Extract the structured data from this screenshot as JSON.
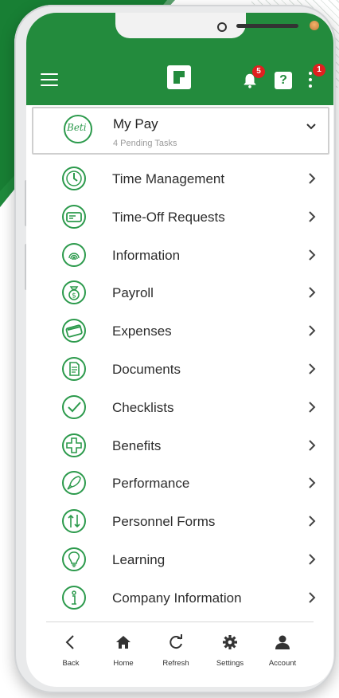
{
  "app": {
    "notification_count": "5",
    "menu_badge_count": "1",
    "help_glyph": "?"
  },
  "mypay": {
    "title": "My Pay",
    "subtitle": "4 Pending Tasks",
    "logo_text": "Beti"
  },
  "menu": [
    {
      "label": "Time Management",
      "icon": "clock-icon"
    },
    {
      "label": "Time-Off Requests",
      "icon": "timeoff-ticket-icon"
    },
    {
      "label": "Information",
      "icon": "fingerprint-icon"
    },
    {
      "label": "Payroll",
      "icon": "money-bag-icon"
    },
    {
      "label": "Expenses",
      "icon": "credit-card-icon"
    },
    {
      "label": "Documents",
      "icon": "document-icon"
    },
    {
      "label": "Checklists",
      "icon": "checkmark-icon"
    },
    {
      "label": "Benefits",
      "icon": "medical-cross-icon"
    },
    {
      "label": "Performance",
      "icon": "rocket-icon"
    },
    {
      "label": "Personnel Forms",
      "icon": "arrows-updown-icon"
    },
    {
      "label": "Learning",
      "icon": "lightbulb-icon"
    },
    {
      "label": "Company Information",
      "icon": "info-icon"
    }
  ],
  "nav": {
    "back": "Back",
    "home": "Home",
    "refresh": "Refresh",
    "settings": "Settings",
    "account": "Account"
  },
  "colors": {
    "brand_green": "#238b3d",
    "badge_red": "#e02020"
  }
}
